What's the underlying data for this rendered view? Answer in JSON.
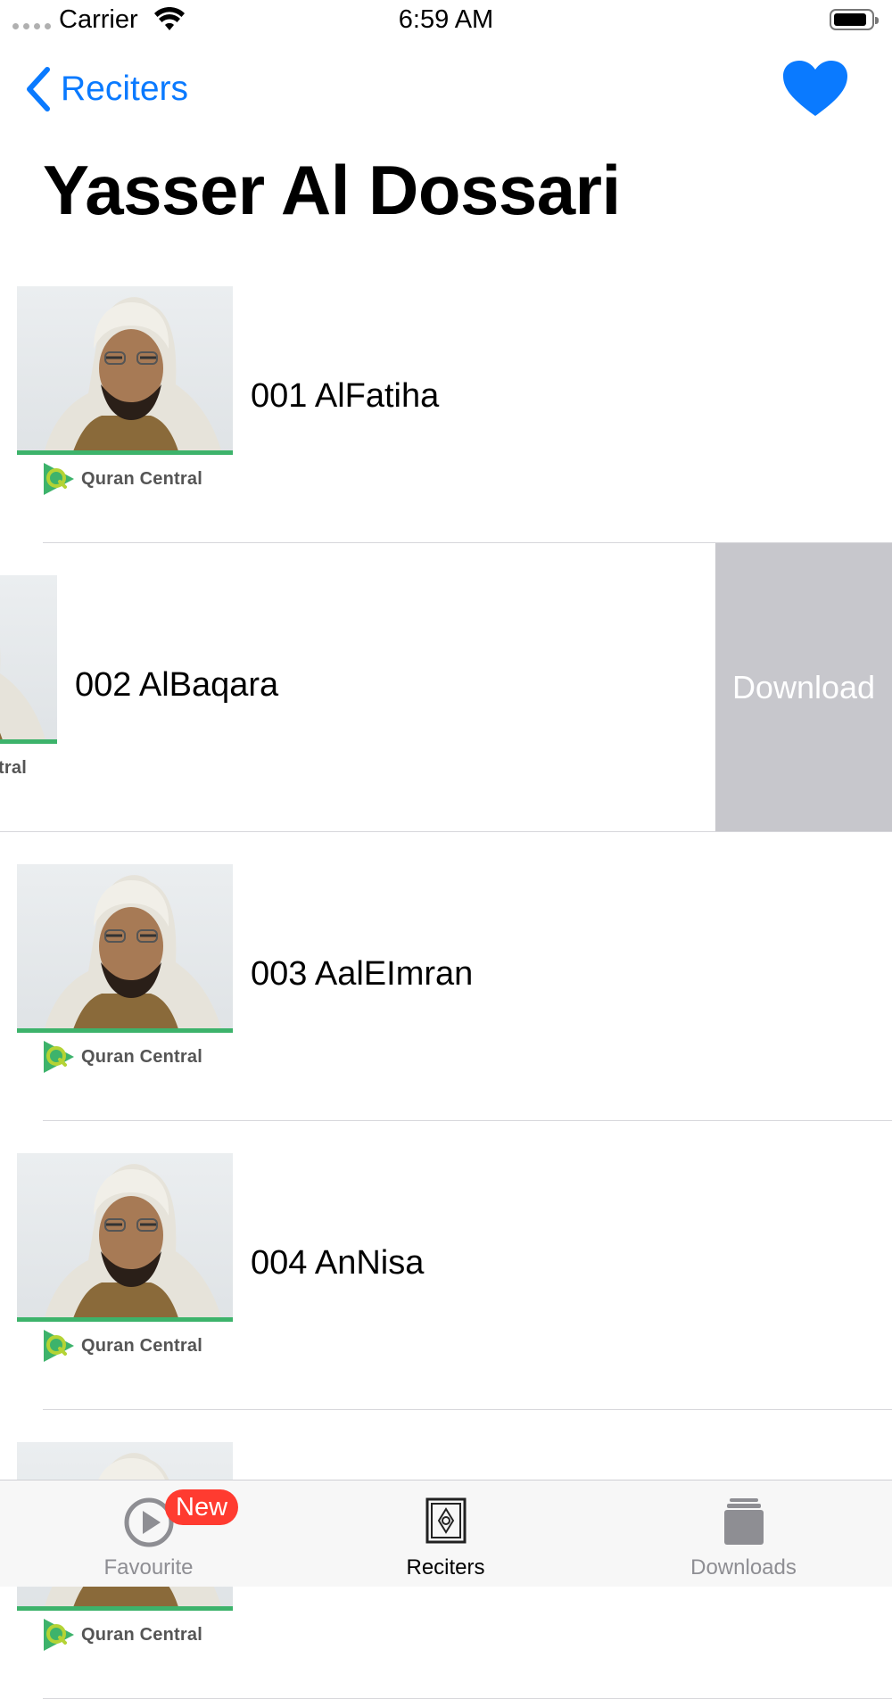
{
  "status_bar": {
    "carrier": "Carrier",
    "time": "6:59 AM"
  },
  "nav": {
    "back_label": "Reciters",
    "title": "Yasser Al Dossari"
  },
  "rows": [
    {
      "title": "001 AlFatiha",
      "logo_text": "Quran Central"
    },
    {
      "title": "002 AlBaqara",
      "logo_text": "Quran Central",
      "action": "Download"
    },
    {
      "title": "003 AalEImran",
      "logo_text": "Quran Central"
    },
    {
      "title": "004 AnNisa",
      "logo_text": "Quran Central"
    },
    {
      "title": "",
      "logo_text": "Quran Central"
    }
  ],
  "tab_bar": {
    "tabs": [
      {
        "label": "Favourite",
        "badge": "New",
        "icon": "play-circle-icon"
      },
      {
        "label": "Reciters",
        "icon": "quran-book-icon"
      },
      {
        "label": "Downloads",
        "icon": "stack-icon"
      }
    ],
    "active_index": 1
  },
  "colors": {
    "accent": "#0a7aff",
    "photo_stripe": "#3db36b",
    "swipe_action_bg": "#c7c7cc",
    "badge": "#ff3b30"
  }
}
